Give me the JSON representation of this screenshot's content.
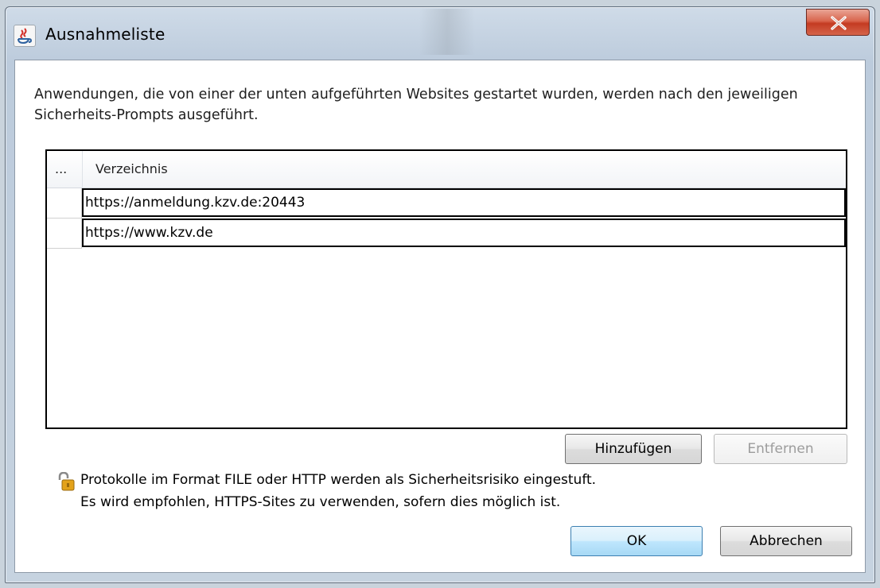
{
  "window": {
    "title": "Ausnahmeliste",
    "close_label": "X"
  },
  "description": "Anwendungen, die von einer der unten aufgeführten Websites gestartet wurden, werden nach den jeweiligen Sicherheits-Prompts ausgeführt.",
  "table": {
    "columns": [
      "...",
      "Verzeichnis"
    ],
    "rows": [
      "https://anmeldung.kzv.de:20443",
      "https://www.kzv.de"
    ]
  },
  "buttons": {
    "add": "Hinzufügen",
    "remove": "Entfernen",
    "ok": "OK",
    "cancel": "Abbrechen"
  },
  "warning": {
    "line1": "Protokolle im Format FILE oder HTTP werden als Sicherheitsrisiko eingestuft.",
    "line2": "Es wird empfohlen, HTTPS-Sites zu verwenden, sofern dies möglich ist."
  },
  "icons": {
    "app": "java-icon",
    "close": "close-icon",
    "warning": "unlocked-padlock-icon"
  },
  "colors": {
    "close_button": "#c43b22",
    "default_button_border": "#3c7fb1"
  }
}
